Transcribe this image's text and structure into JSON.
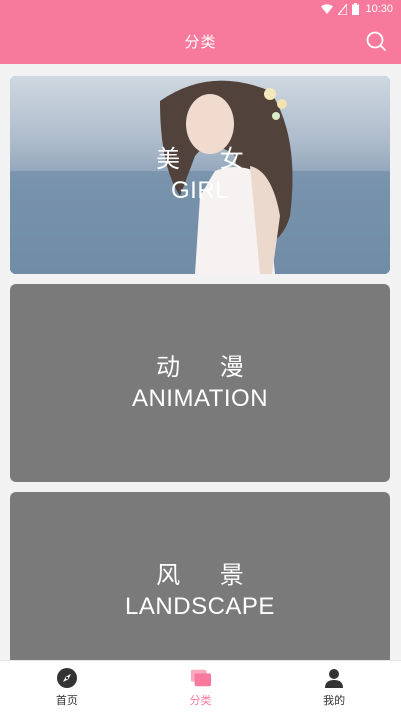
{
  "status_bar": {
    "time": "10:30",
    "icons": [
      "wifi-icon",
      "signal-icon",
      "battery-icon"
    ]
  },
  "app_bar": {
    "title": "分类",
    "search_icon": "search-icon"
  },
  "categories": [
    {
      "cn": "美 女",
      "en": "GIRL"
    },
    {
      "cn": "动 漫",
      "en": "ANIMATION"
    },
    {
      "cn": "风 景",
      "en": "LANDSCAPE"
    }
  ],
  "bottom_nav": {
    "items": [
      {
        "label": "首页",
        "icon": "compass-icon"
      },
      {
        "label": "分类",
        "icon": "cards-icon",
        "active": true
      },
      {
        "label": "我的",
        "icon": "user-icon"
      }
    ]
  },
  "colors": {
    "accent": "#f77a9c",
    "card_gray": "#7a7a7a",
    "background": "#f2f2f2"
  }
}
